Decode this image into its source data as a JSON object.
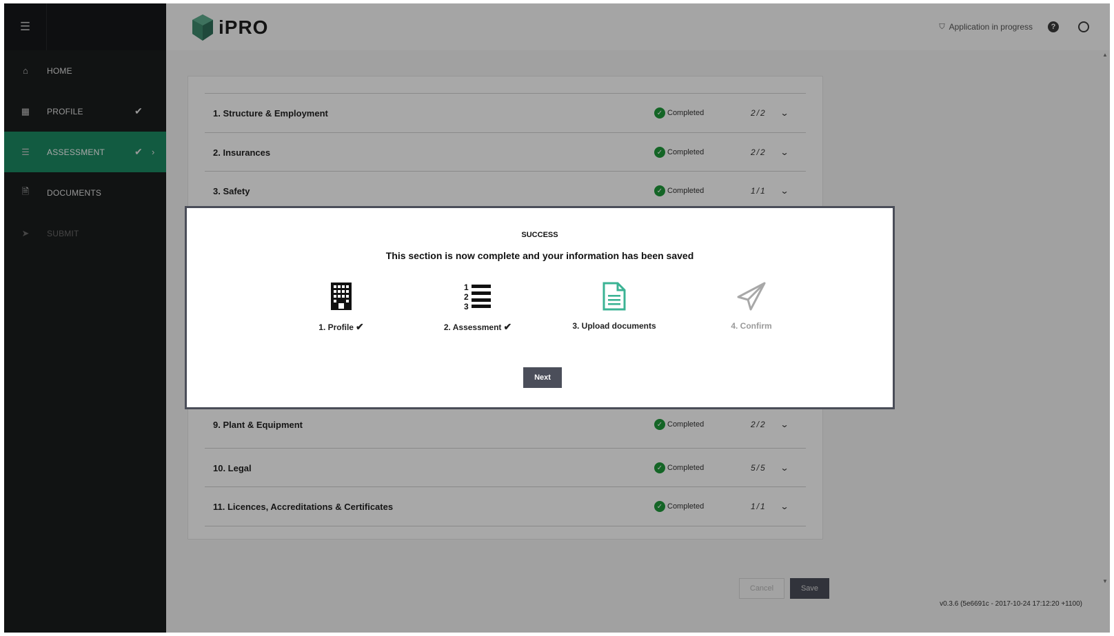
{
  "sidebar": {
    "menu_icon": "hamburger-icon",
    "items": [
      {
        "label": "HOME",
        "icon": "home-icon",
        "check": "",
        "chevron": ""
      },
      {
        "label": "PROFILE",
        "icon": "building-icon",
        "check": "✔",
        "chevron": ""
      },
      {
        "label": "ASSESSMENT",
        "icon": "list-icon",
        "check": "✔",
        "chevron": "›"
      },
      {
        "label": "DOCUMENTS",
        "icon": "document-icon",
        "check": "",
        "chevron": ""
      },
      {
        "label": "SUBMIT",
        "icon": "paper-plane-icon",
        "check": "",
        "chevron": ""
      }
    ]
  },
  "header": {
    "app_name": "iPRO",
    "status_text": "Application in progress",
    "help_glyph": "?",
    "shield_glyph": "⛉"
  },
  "sections": {
    "status_label": "Completed",
    "rows": [
      {
        "title": "1. Structure & Employment",
        "count": "2/2"
      },
      {
        "title": "2. Insurances",
        "count": "2/2"
      },
      {
        "title": "3. Safety",
        "count": "1/1"
      },
      {
        "title": "9. Plant & Equipment",
        "count": "2/2"
      },
      {
        "title": "10. Legal",
        "count": "5/5"
      },
      {
        "title": "11. Licences, Accreditations & Certificates",
        "count": "1/1"
      }
    ]
  },
  "footer": {
    "cancel_label": "Cancel",
    "save_label": "Save",
    "version": "v0.3.6 (5e6691c - 2017-10-24 17:12:20 +1100)"
  },
  "modal": {
    "title": "SUCCESS",
    "message": "This section is now complete and your information has been saved",
    "steps": [
      {
        "label": "1. Profile",
        "tick": "✔",
        "icon": "building-icon",
        "state": "done"
      },
      {
        "label": "2. Assessment",
        "tick": "✔",
        "icon": "numbered-list-icon",
        "state": "done"
      },
      {
        "label": "3. Upload documents",
        "tick": "",
        "icon": "document-icon",
        "state": "current"
      },
      {
        "label": "4. Confirm",
        "tick": "",
        "icon": "paper-plane-icon",
        "state": "future"
      }
    ],
    "next_label": "Next"
  },
  "colors": {
    "active_nav": "#1c8a63",
    "completed_green": "#1f9a3b",
    "current_step": "#3bb394",
    "button_dark": "#4b4e5a"
  }
}
